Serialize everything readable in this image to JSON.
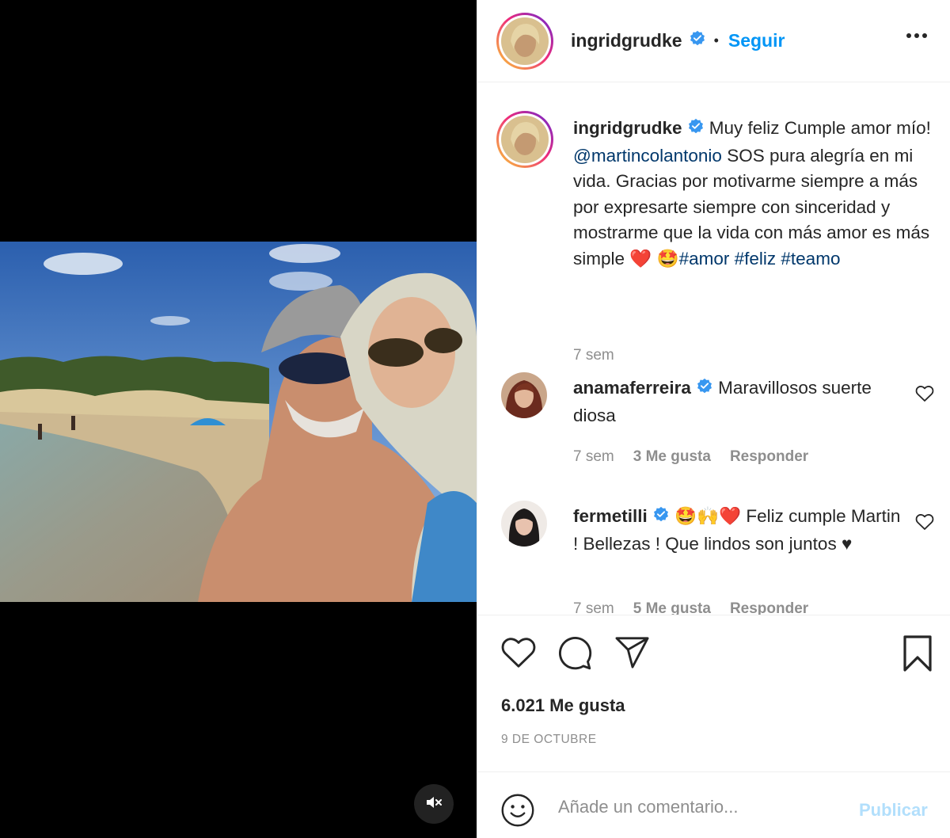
{
  "post": {
    "author": "ingridgrudke",
    "dot": "•",
    "follow_label": "Seguir"
  },
  "caption": {
    "author": "ingridgrudke",
    "text_part1": " Muy feliz Cumple amor mío! ",
    "mention": "@martincolantonio",
    "text_part2": " SOS pura alegría en mi vida. Gracias por motivarme siempre a más por expresarte siempre con sinceridad y mostrarme que la vida con más amor es más simple ❤️ 🤩",
    "tags": [
      "#amor",
      "#feliz",
      "#teamo"
    ],
    "time": "7 sem"
  },
  "comments": [
    {
      "author": "anamaferreira",
      "text": " Maravillosos suerte diosa",
      "time": "7 sem",
      "likes": "3 Me gusta",
      "reply": "Responder"
    },
    {
      "author": "fermetilli",
      "text": " 🤩🙌❤️ Feliz cumple Martin ! Bellezas ! Que lindos son juntos ♥",
      "time": "7 sem",
      "likes": "5 Me gusta",
      "reply": "Responder"
    }
  ],
  "stats": {
    "likes": "6.021 Me gusta",
    "date": "9 DE OCTUBRE"
  },
  "add_comment": {
    "placeholder": "Añade un comentario...",
    "publish": "Publicar"
  },
  "icons": {
    "verified": "verified-badge-icon",
    "more": "more-options-icon",
    "like": "heart-icon",
    "comment": "comment-bubble-icon",
    "share": "paper-plane-icon",
    "save": "bookmark-icon",
    "emoji": "smiley-icon",
    "mute": "speaker-muted-icon"
  },
  "colors": {
    "accent": "#0095f6",
    "publish_disabled": "#b2dffc",
    "muted_text": "#8e8e8e",
    "link": "#00376b",
    "verified": "#3897f0"
  }
}
